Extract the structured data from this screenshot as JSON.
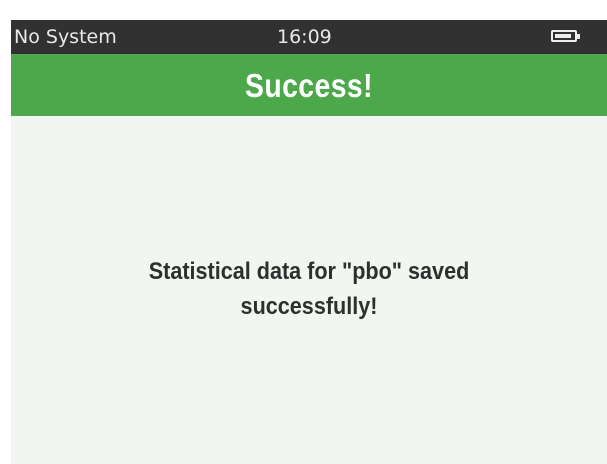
{
  "status_bar": {
    "system_label": "No System",
    "time": "16:09",
    "battery_icon": "battery-icon",
    "battery_level": 0.9
  },
  "header": {
    "title": "Success!",
    "color": "#4ca84a"
  },
  "message": {
    "line1": "Statistical data for \"pbo\" saved",
    "line2": "successfully!"
  },
  "colors": {
    "status_bar_bg": "#313131",
    "title_bar_bg": "#4ca84a",
    "content_bg": "#f1f6f1",
    "message_text": "#2f2f2f"
  }
}
